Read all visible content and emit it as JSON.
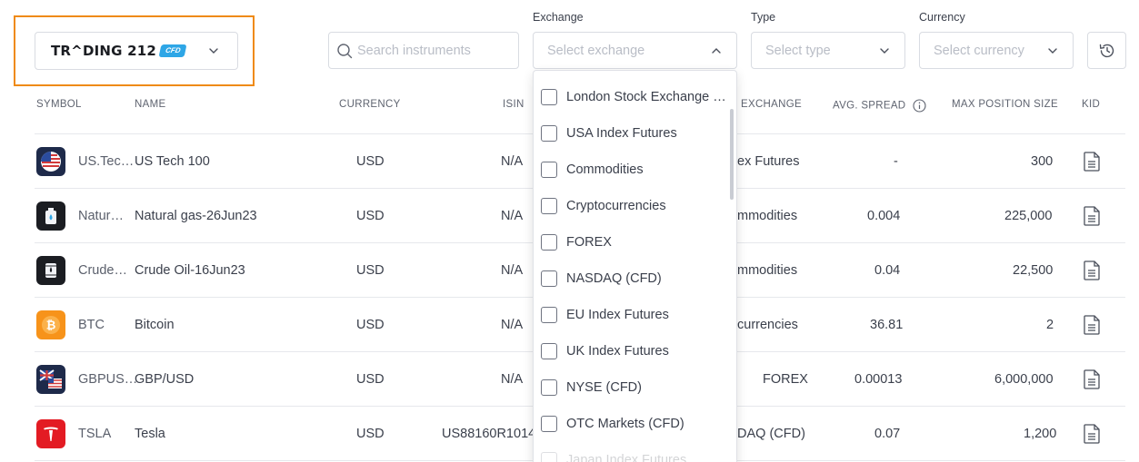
{
  "brand": {
    "name": "TR^DING 212",
    "badge": "CFD"
  },
  "search": {
    "placeholder": "Search instruments"
  },
  "filters": {
    "exchange": {
      "label": "Exchange",
      "placeholder": "Select exchange"
    },
    "type": {
      "label": "Type",
      "placeholder": "Select type"
    },
    "currency": {
      "label": "Currency",
      "placeholder": "Select currency"
    }
  },
  "table": {
    "headers": {
      "symbol": "SYMBOL",
      "name": "NAME",
      "currency": "CURRENCY",
      "isin": "ISIN",
      "exchange": "EXCHANGE",
      "spread": "AVG. SPREAD",
      "max_position": "MAX POSITION SIZE",
      "kid": "KID"
    },
    "rows": [
      {
        "symbol": "US.Tec…",
        "name": "US Tech 100",
        "currency": "USD",
        "isin": "N/A",
        "exchange": "ex Futures",
        "spread": "-",
        "max_position": "300",
        "icon": "us-flag-icon"
      },
      {
        "symbol": "Natur…",
        "name": "Natural gas-26Jun23",
        "currency": "USD",
        "isin": "N/A",
        "exchange": "mmodities",
        "spread": "0.004",
        "max_position": "225,000",
        "icon": "gas-can-icon"
      },
      {
        "symbol": "Crude…",
        "name": "Crude Oil-16Jun23",
        "currency": "USD",
        "isin": "N/A",
        "exchange": "mmodities",
        "spread": "0.04",
        "max_position": "22,500",
        "icon": "oil-barrel-icon"
      },
      {
        "symbol": "BTC",
        "name": "Bitcoin",
        "currency": "USD",
        "isin": "N/A",
        "exchange": "currencies",
        "spread": "36.81",
        "max_position": "2",
        "icon": "bitcoin-icon"
      },
      {
        "symbol": "GBPUS…",
        "name": "GBP/USD",
        "currency": "USD",
        "isin": "N/A",
        "exchange": "FOREX",
        "spread": "0.00013",
        "max_position": "6,000,000",
        "icon": "gbp-usd-flags-icon"
      },
      {
        "symbol": "TSLA",
        "name": "Tesla",
        "currency": "USD",
        "isin": "US88160R1014",
        "exchange": "DAQ (CFD)",
        "spread": "0.07",
        "max_position": "1,200",
        "icon": "tesla-logo-icon"
      }
    ]
  },
  "exchange_dropdown": {
    "options": [
      "London Stock Exchange …",
      "USA Index Futures",
      "Commodities",
      "Cryptocurrencies",
      "FOREX",
      "NASDAQ (CFD)",
      "EU Index Futures",
      "UK Index Futures",
      "NYSE (CFD)",
      "OTC Markets (CFD)",
      "Japan Index Futures"
    ]
  },
  "colors": {
    "highlight_frame": "#ef8a14",
    "cfd_badge": "#2ea6e6",
    "border": "#d9dce2"
  }
}
